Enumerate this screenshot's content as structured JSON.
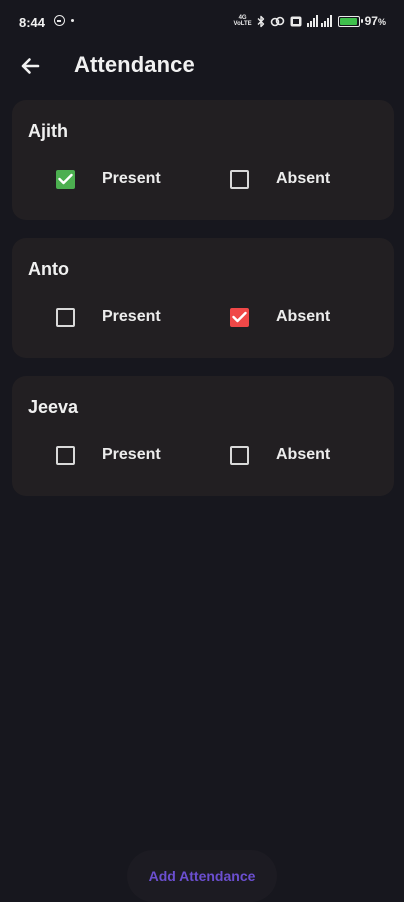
{
  "status_bar": {
    "time": "8:44",
    "network_labels": [
      "4G",
      "VoLTE"
    ],
    "battery_percent": "97",
    "battery_suffix": "%",
    "battery_color": "#3fbf4c",
    "icons": [
      "face-icon",
      "dot-icon",
      "network-icon",
      "bluetooth-icon",
      "link-icon",
      "cast-icon",
      "signal-icon",
      "battery-icon"
    ]
  },
  "app_bar": {
    "title": "Attendance",
    "back_icon": "arrow-left-icon"
  },
  "students": [
    {
      "name": "Ajith",
      "present_label": "Present",
      "absent_label": "Absent",
      "present": true,
      "absent": false
    },
    {
      "name": "Anto",
      "present_label": "Present",
      "absent_label": "Absent",
      "present": false,
      "absent": true
    },
    {
      "name": "Jeeva",
      "present_label": "Present",
      "absent_label": "Absent",
      "present": false,
      "absent": false
    }
  ],
  "colors": {
    "background": "#17171e",
    "card": "#221f22",
    "present_checked": "#4caf50",
    "absent_checked": "#f04848",
    "accent": "#6b4fd0"
  },
  "footer": {
    "add_button_label": "Add Attendance"
  }
}
